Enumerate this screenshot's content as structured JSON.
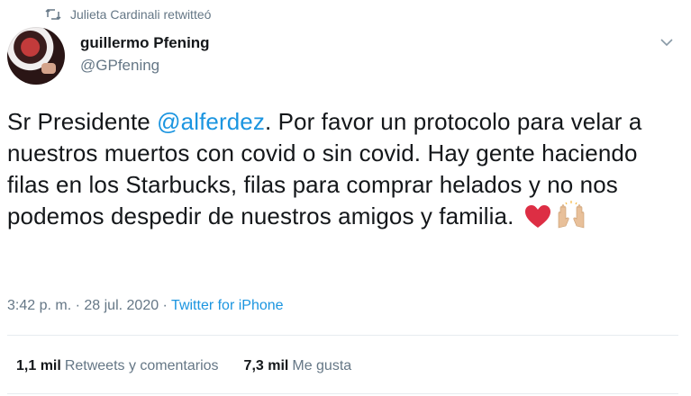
{
  "retweet": {
    "icon": "retweet-icon",
    "text": "Julieta Cardinali retwitteó"
  },
  "author": {
    "display_name": "guillermo Pfening",
    "handle": "@GPfening"
  },
  "tweet": {
    "text_before": "Sr Presidente ",
    "mention": "@alferdez",
    "text_after": ". Por favor un protocolo para velar a nuestros muertos con covid o sin covid. Hay gente haciendo filas en los Starbucks, filas para comprar helados y no nos podemos despedir de nuestros amigos y familia. ",
    "emojis": [
      "red-heart-icon",
      "raised-hands-icon"
    ]
  },
  "meta": {
    "time": "3:42 p. m.",
    "separator1": " · ",
    "date": "28 jul. 2020",
    "separator2": " · ",
    "source": "Twitter for iPhone"
  },
  "stats": {
    "retweets_count": "1,1 mil",
    "retweets_label": "Retweets y comentarios",
    "likes_count": "7,3 mil",
    "likes_label": "Me gusta"
  },
  "colors": {
    "mention": "#1b95e0",
    "secondary_text": "#657786",
    "primary_text": "#14171a",
    "divider": "#e6ecf0"
  }
}
